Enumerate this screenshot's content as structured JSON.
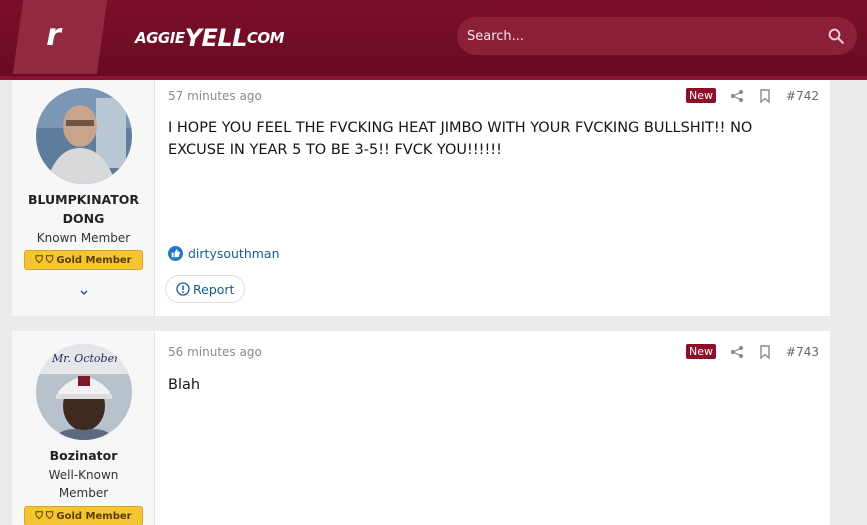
{
  "header": {
    "logo_letter": "r",
    "brand_prefix": "AGGIE",
    "brand_mid": "YELL",
    "brand_suffix": "COM",
    "search_placeholder": "Search..."
  },
  "posts": [
    {
      "username_line1": "BLUMPKINATOR",
      "username_line2": "DONG",
      "user_title": "Known Member",
      "membership_badge": "Gold Member",
      "timestamp": "57 minutes ago",
      "new_label": "New",
      "post_number": "#742",
      "body": "I HOPE YOU FEEL THE FVCKING HEAT JIMBO WITH YOUR FVCKING BULLSHIT!! NO EXCUSE IN YEAR 5 TO BE 3-5!! FVCK YOU!!!!!!",
      "reaction_user": "dirtysouthman",
      "report_label": "Report"
    },
    {
      "username_line1": "Bozinator",
      "user_title_line1": "Well-Known",
      "user_title_line2": "Member",
      "membership_badge": "Gold Member",
      "avatar_text": "Mr. October",
      "timestamp": "56 minutes ago",
      "new_label": "New",
      "post_number": "#743",
      "body": "Blah"
    }
  ],
  "colors": {
    "header_bg": "#6a0b22",
    "accent": "#8c0f2a",
    "gold_badge": "#f4c533",
    "link": "#1a5a94"
  }
}
